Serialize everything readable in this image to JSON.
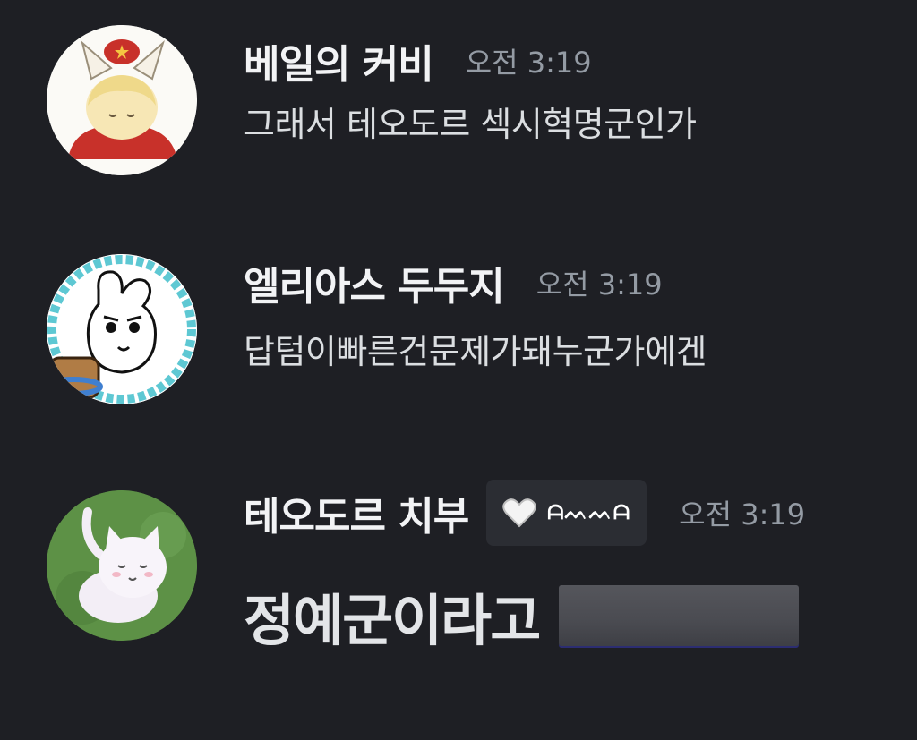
{
  "messages": [
    {
      "username": "베일의 커비",
      "timestamp": "오전 3:19",
      "text": "그래서 테오도르 섹시혁명군인가",
      "avatar_icon": "cat-boy-with-red-hat-avatar"
    },
    {
      "username": "엘리아스 두두지",
      "timestamp": "오전 3:19",
      "text": "답텀이빠른건문제가돼누군가에겐",
      "avatar_icon": "pixel-rabbit-with-capybara-avatar"
    },
    {
      "username": "테오도르 치부",
      "timestamp": "오전 3:19",
      "tag": {
        "icon": "white-heart-icon",
        "label": "ᗩᨓᨓᗩ"
      },
      "text": "정예군이라고",
      "avatar_icon": "white-cat-on-grass-avatar"
    }
  ],
  "colors": {
    "background": "#1e1f24",
    "username": "#f2f3f5",
    "timestamp": "#949ba4",
    "message_text": "#dbdee1",
    "tag_background": "#2b2d33"
  }
}
